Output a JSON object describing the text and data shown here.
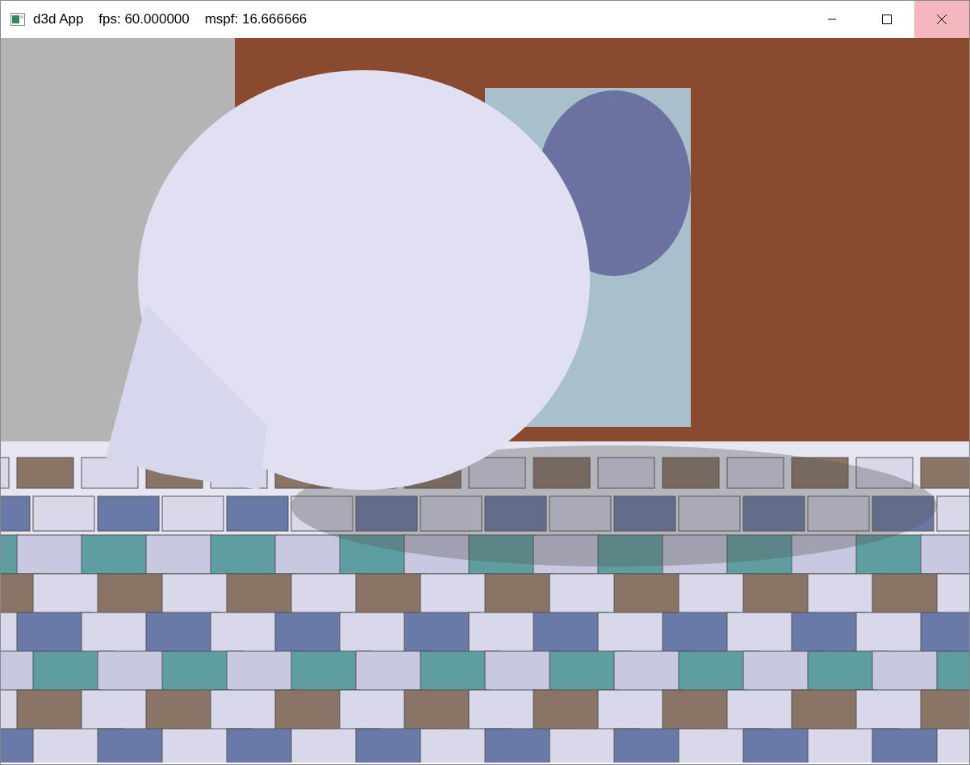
{
  "window": {
    "title": "d3d App    fps: 60.000000    mspf: 16.666666",
    "active_close": true
  }
}
